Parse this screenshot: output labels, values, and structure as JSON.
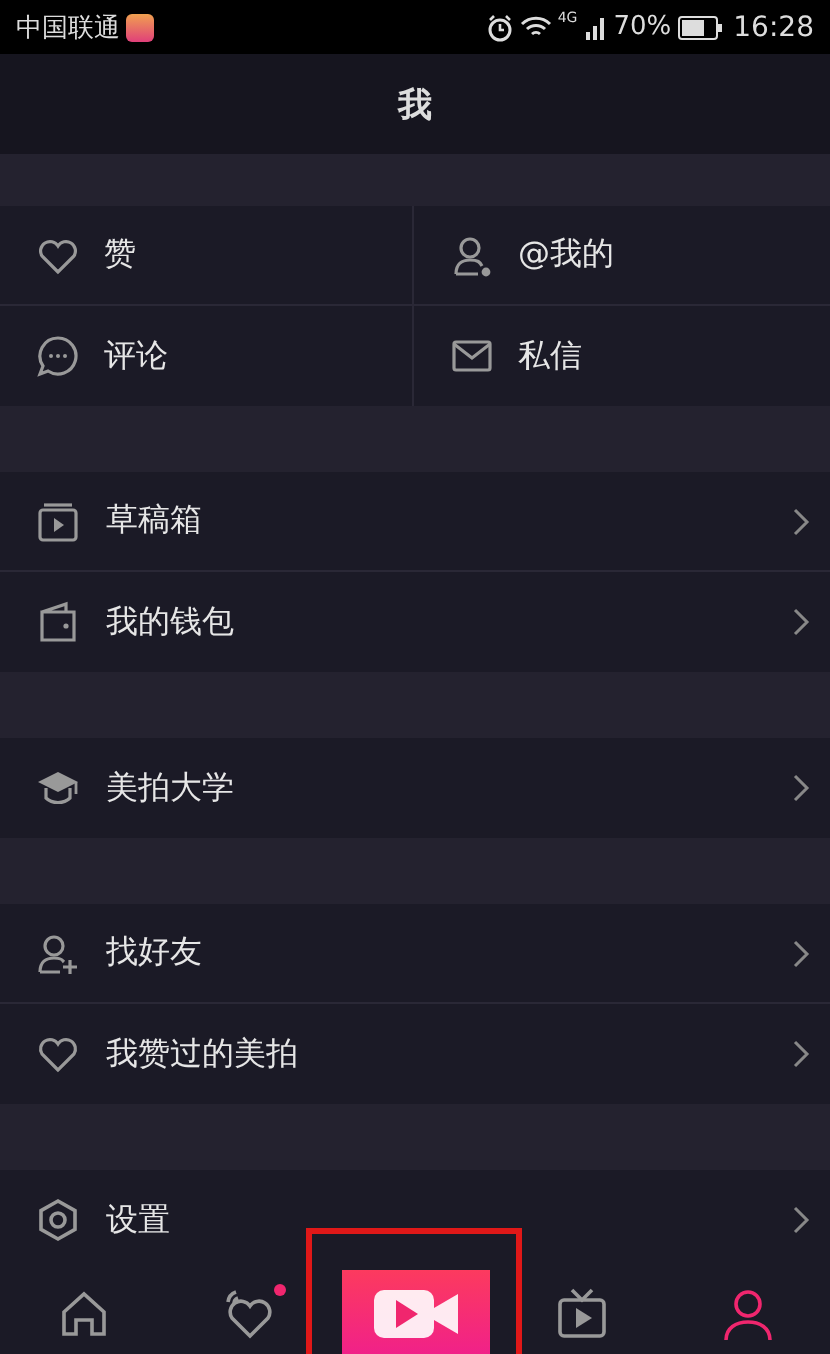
{
  "status_bar": {
    "carrier": "中国联通",
    "network": "4G",
    "battery": "70%",
    "time": "16:28"
  },
  "header": {
    "title": "我"
  },
  "grid": [
    {
      "kind": "heart",
      "label": "赞"
    },
    {
      "kind": "user",
      "label": "@我的"
    },
    {
      "kind": "comment",
      "label": "评论"
    },
    {
      "kind": "mail",
      "label": "私信"
    }
  ],
  "sections": [
    [
      {
        "kind": "drafts",
        "label": "草稿箱"
      },
      {
        "kind": "wallet",
        "label": "我的钱包"
      }
    ],
    [
      {
        "kind": "cap",
        "label": "美拍大学"
      }
    ],
    [
      {
        "kind": "adduser",
        "label": "找好友"
      },
      {
        "kind": "heart",
        "label": "我赞过的美拍"
      }
    ],
    [
      {
        "kind": "gear",
        "label": "设置"
      }
    ]
  ],
  "tabs": [
    {
      "kind": "home",
      "selected": false,
      "badge": false
    },
    {
      "kind": "heartwave",
      "selected": false,
      "badge": true
    },
    {
      "kind": "record",
      "selected": false,
      "badge": false,
      "highlighted": true
    },
    {
      "kind": "tv",
      "selected": false,
      "badge": false
    },
    {
      "kind": "person",
      "selected": true,
      "badge": false
    }
  ]
}
